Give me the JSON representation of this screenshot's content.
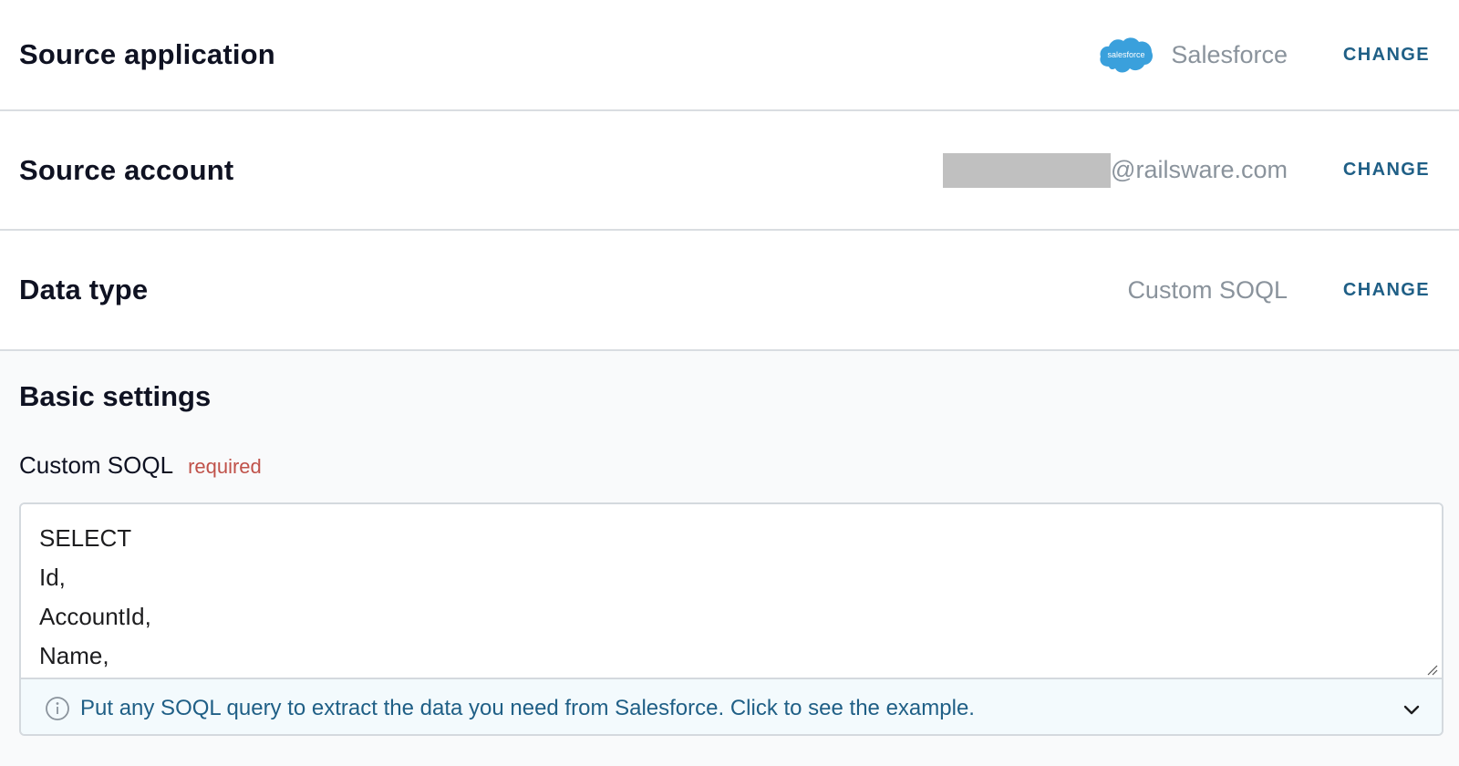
{
  "source_application": {
    "title": "Source application",
    "value": "Salesforce",
    "logo_text": "salesforce",
    "change_label": "CHANGE"
  },
  "source_account": {
    "title": "Source account",
    "value": "@railsware.com",
    "change_label": "CHANGE"
  },
  "data_type": {
    "title": "Data type",
    "value": "Custom SOQL",
    "change_label": "CHANGE"
  },
  "basic_settings": {
    "title": "Basic settings",
    "field_label": "Custom SOQL",
    "required_label": "required",
    "query_value": "SELECT\nId,\nAccountId,\nName,",
    "hint_text": "Put any SOQL query to extract the data you need from Salesforce. Click to see the example."
  },
  "colors": {
    "accent": "#1f5f86",
    "required": "#c0524a",
    "salesforce_blue": "#3aa0dc"
  },
  "icons": {
    "info": "info-icon",
    "chevron": "chevron-down-icon",
    "logo": "salesforce-logo"
  }
}
